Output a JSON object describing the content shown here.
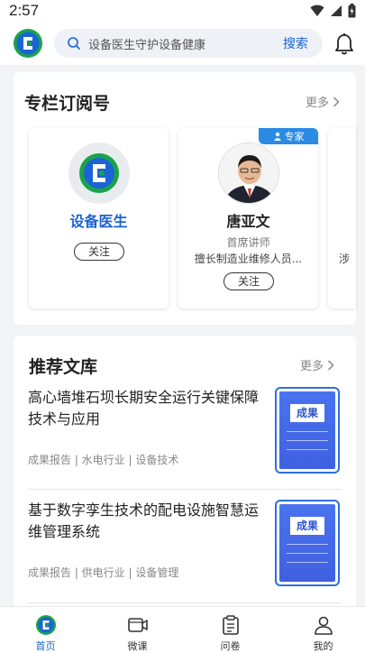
{
  "status_bar": {
    "time": "2:57"
  },
  "header": {
    "search_placeholder": "设备医生守护设备健康",
    "search_button": "搜索"
  },
  "column_section": {
    "title": "专栏订阅号",
    "more": "更多",
    "cards": [
      {
        "name": "设备医生",
        "follow": "关注"
      },
      {
        "name": "唐亚文",
        "role": "首席讲师",
        "desc": "擅长制造业维修人员...",
        "follow": "关注",
        "tag": "专家"
      },
      {
        "desc_partial": "涉"
      }
    ]
  },
  "library_section": {
    "title": "推荐文库",
    "more": "更多",
    "items": [
      {
        "title": "高心墙堆石坝长期安全运行关键保障技术与应用",
        "tags": "成果报告 | 水电行业 | 设备技术",
        "thumb_label": "成果"
      },
      {
        "title": "基于数字孪生技术的配电设施智慧运维管理系统",
        "tags": "成果报告 | 供电行业 | 设备管理",
        "thumb_label": "成果"
      }
    ]
  },
  "tabbar": {
    "items": [
      {
        "label": "首页",
        "icon": "home-logo-icon",
        "active": true
      },
      {
        "label": "微课",
        "icon": "video-icon"
      },
      {
        "label": "问卷",
        "icon": "clipboard-icon"
      },
      {
        "label": "我的",
        "icon": "user-icon"
      }
    ]
  },
  "colors": {
    "accent": "#1b63d6",
    "brand_green": "#1aa34a",
    "expert_tag": "#2a8ae6"
  }
}
